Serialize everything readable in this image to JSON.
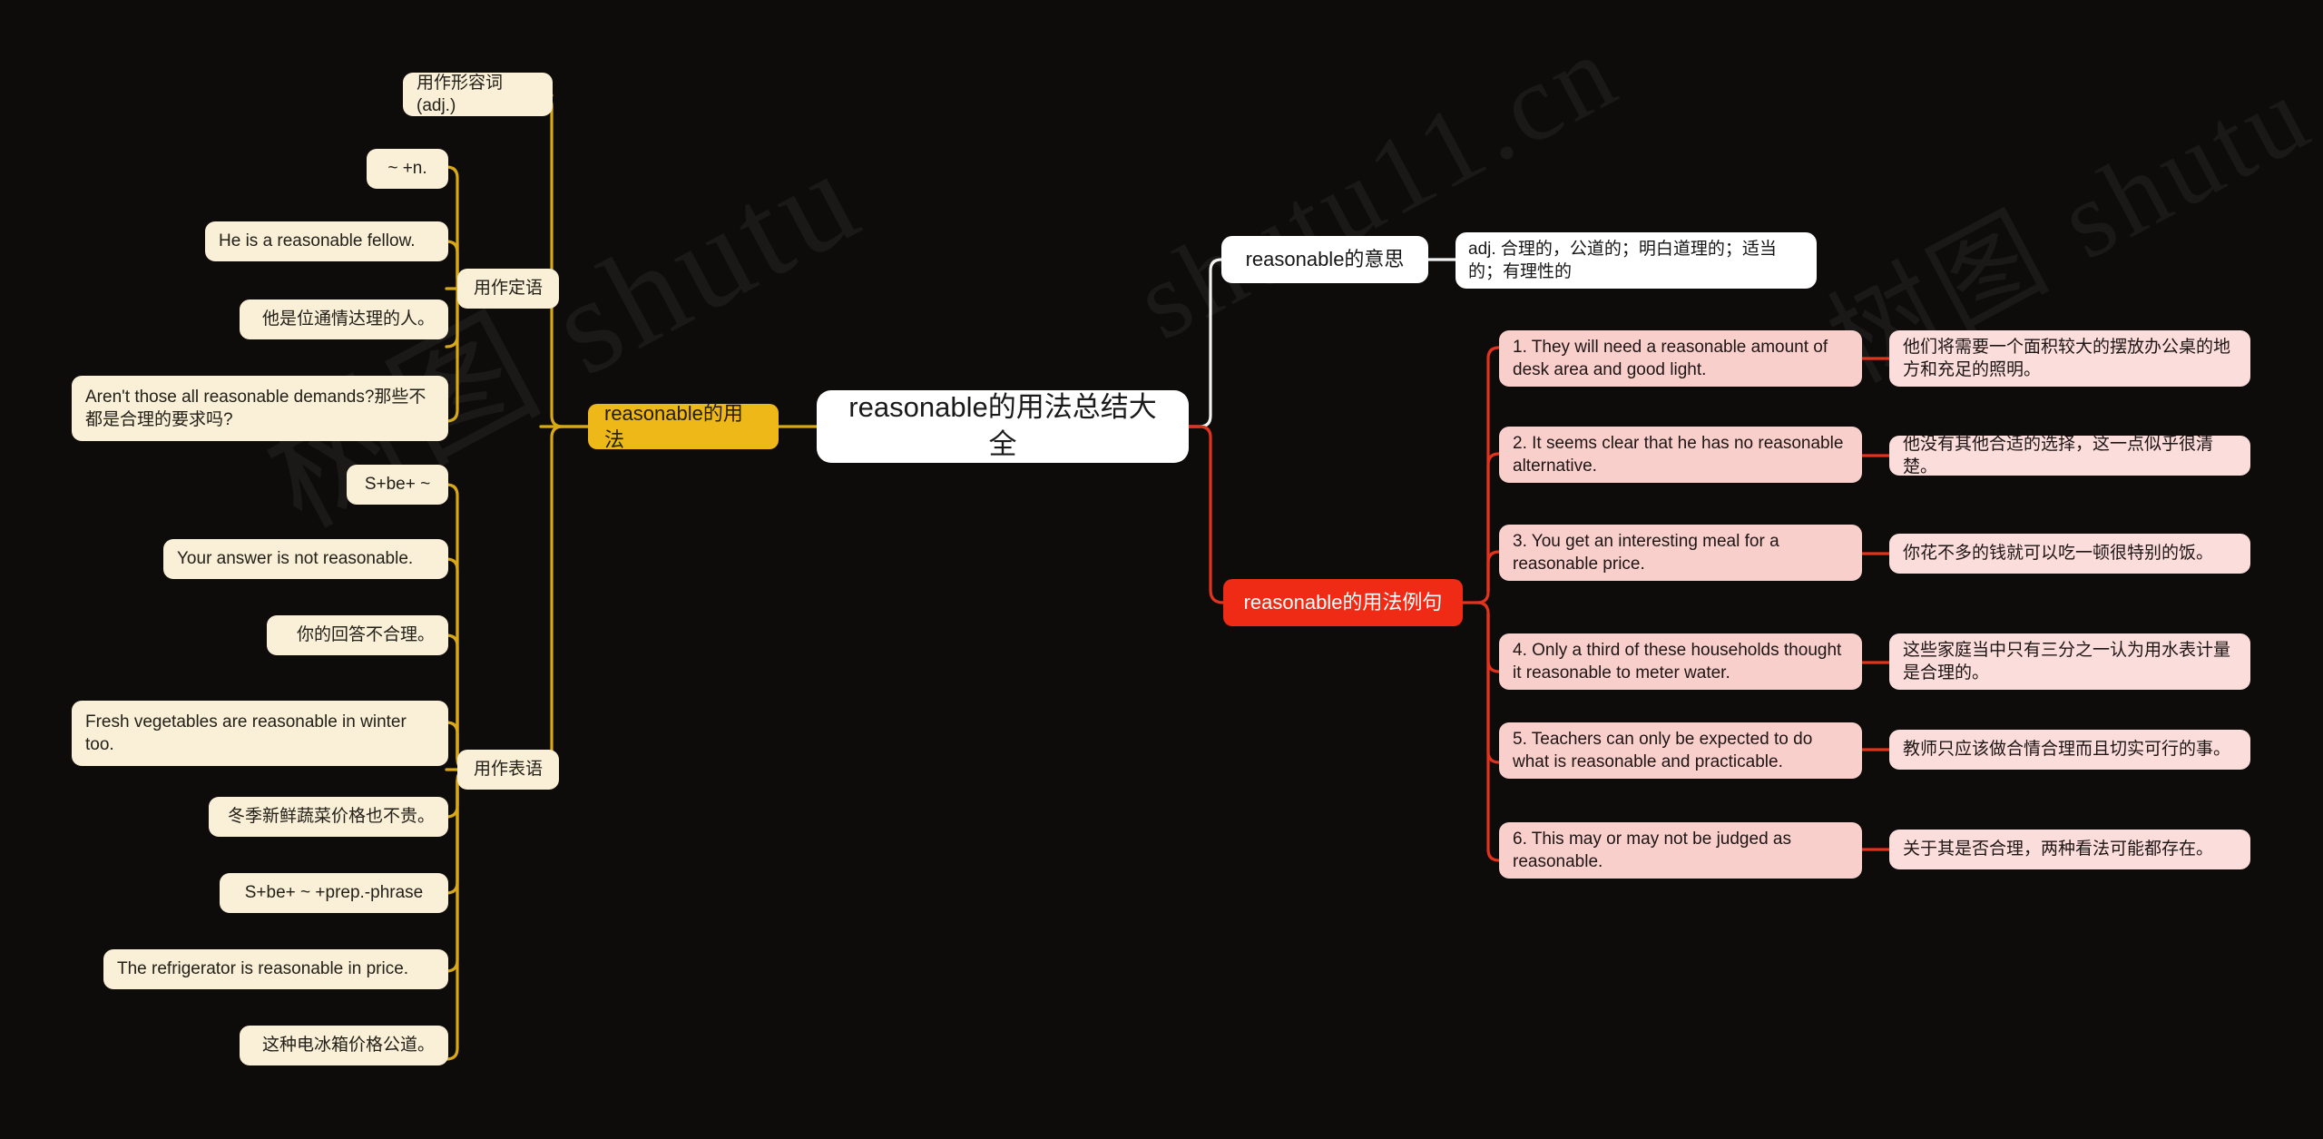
{
  "theme": {
    "background": "#0e0b0b",
    "gold": "#edb818",
    "gold_line": "#d9a819",
    "cream": "#faf0d7",
    "white": "#ffffff",
    "red": "#ef2b16",
    "red_line": "#e1331e",
    "pink_dark": "#f9cfcc",
    "pink_light": "#fbdedb",
    "root_text": "#1a1a1a"
  },
  "watermark": {
    "text_a": "shutu11.cn",
    "text_b": "树图 shutu",
    "text_c": "树图 shutu"
  },
  "root": {
    "label": "reasonable的用法总结大全"
  },
  "left_branch": {
    "label": "reasonable的用法",
    "children": [
      {
        "label": "用作形容词(adj.)"
      },
      {
        "label": "用作定语",
        "children": [
          {
            "label": "~ +n."
          },
          {
            "label": "He is a reasonable fellow."
          },
          {
            "label": "他是位通情达理的人。"
          },
          {
            "label": "Aren't those all reasonable demands?那些不都是合理的要求吗?"
          }
        ]
      },
      {
        "label": "用作表语",
        "children": [
          {
            "label": "S+be+ ~"
          },
          {
            "label": "Your answer is not reasonable."
          },
          {
            "label": "你的回答不合理。"
          },
          {
            "label": "Fresh vegetables are reasonable in winter too."
          },
          {
            "label": "冬季新鲜蔬菜价格也不贵。"
          },
          {
            "label": "S+be+ ~ +prep.-phrase"
          },
          {
            "label": "The refrigerator is reasonable in price."
          },
          {
            "label": "这种电冰箱价格公道。"
          }
        ]
      }
    ]
  },
  "right_branches": {
    "meaning": {
      "label": "reasonable的意思",
      "definition": "adj. 合理的，公道的；明白道理的；适当的；有理性的"
    },
    "examples": {
      "label": "reasonable的用法例句",
      "items": [
        {
          "en": "1. They will need a reasonable amount of desk area and good light.",
          "zh": "他们将需要一个面积较大的摆放办公桌的地方和充足的照明。"
        },
        {
          "en": "2. It seems clear that he has no reasonable alternative.",
          "zh": "他没有其他合适的选择，这一点似乎很清楚。"
        },
        {
          "en": "3. You get an interesting meal for a reasonable price.",
          "zh": "你花不多的钱就可以吃一顿很特别的饭。"
        },
        {
          "en": "4. Only a third of these households thought it reasonable to meter water.",
          "zh": "这些家庭当中只有三分之一认为用水表计量是合理的。"
        },
        {
          "en": "5. Teachers can only be expected to do what is reasonable and practicable.",
          "zh": "教师只应该做合情合理而且切实可行的事。"
        },
        {
          "en": "6. This may or may not be judged as reasonable.",
          "zh": "关于其是否合理，两种看法可能都存在。"
        }
      ]
    }
  }
}
